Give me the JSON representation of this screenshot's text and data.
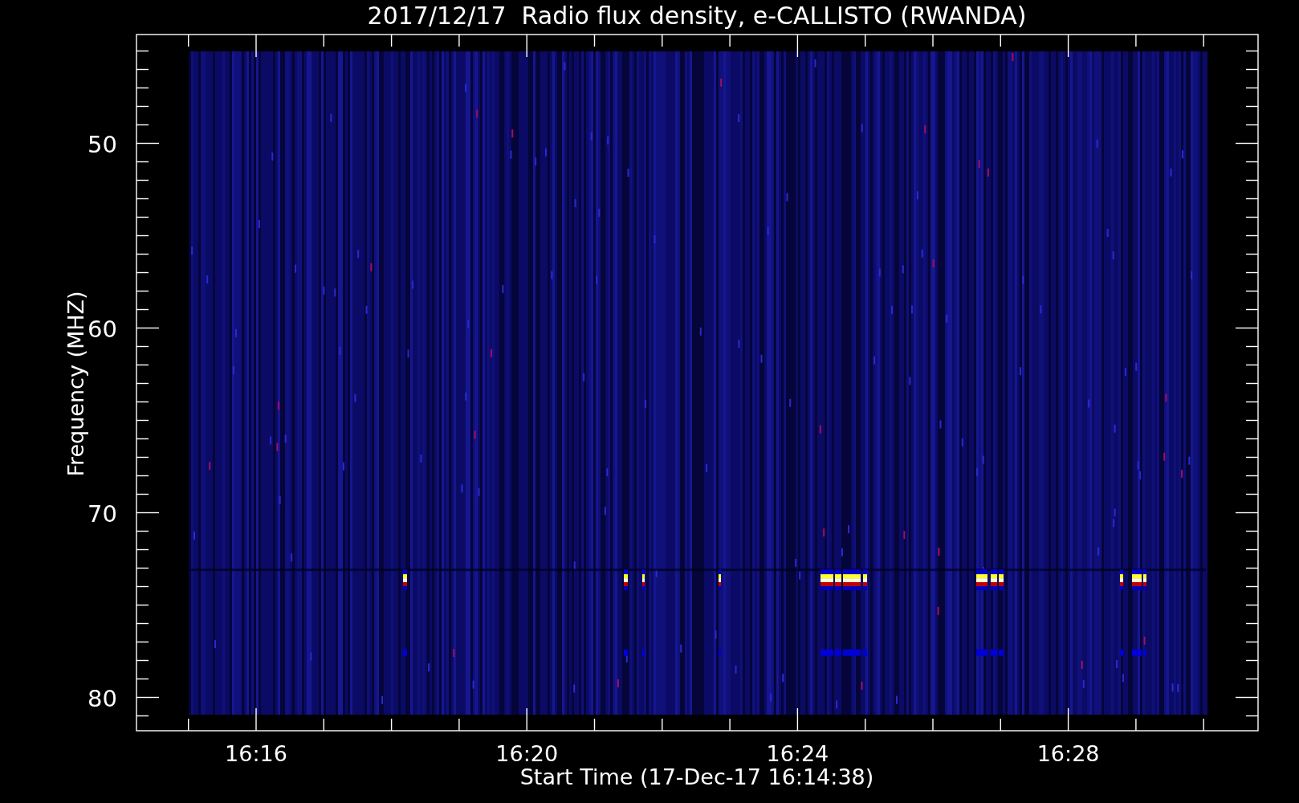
{
  "title": "2017/12/17  Radio flux density, e-CALLISTO (RWANDA)",
  "y_axis": {
    "label": "Frequency (MHZ)",
    "ticks": [
      "50",
      "60",
      "70",
      "80"
    ]
  },
  "x_axis": {
    "label": "Start Time (17-Dec-17 16:14:38)",
    "ticks": [
      "16:16",
      "16:20",
      "16:24",
      "16:28"
    ]
  }
}
